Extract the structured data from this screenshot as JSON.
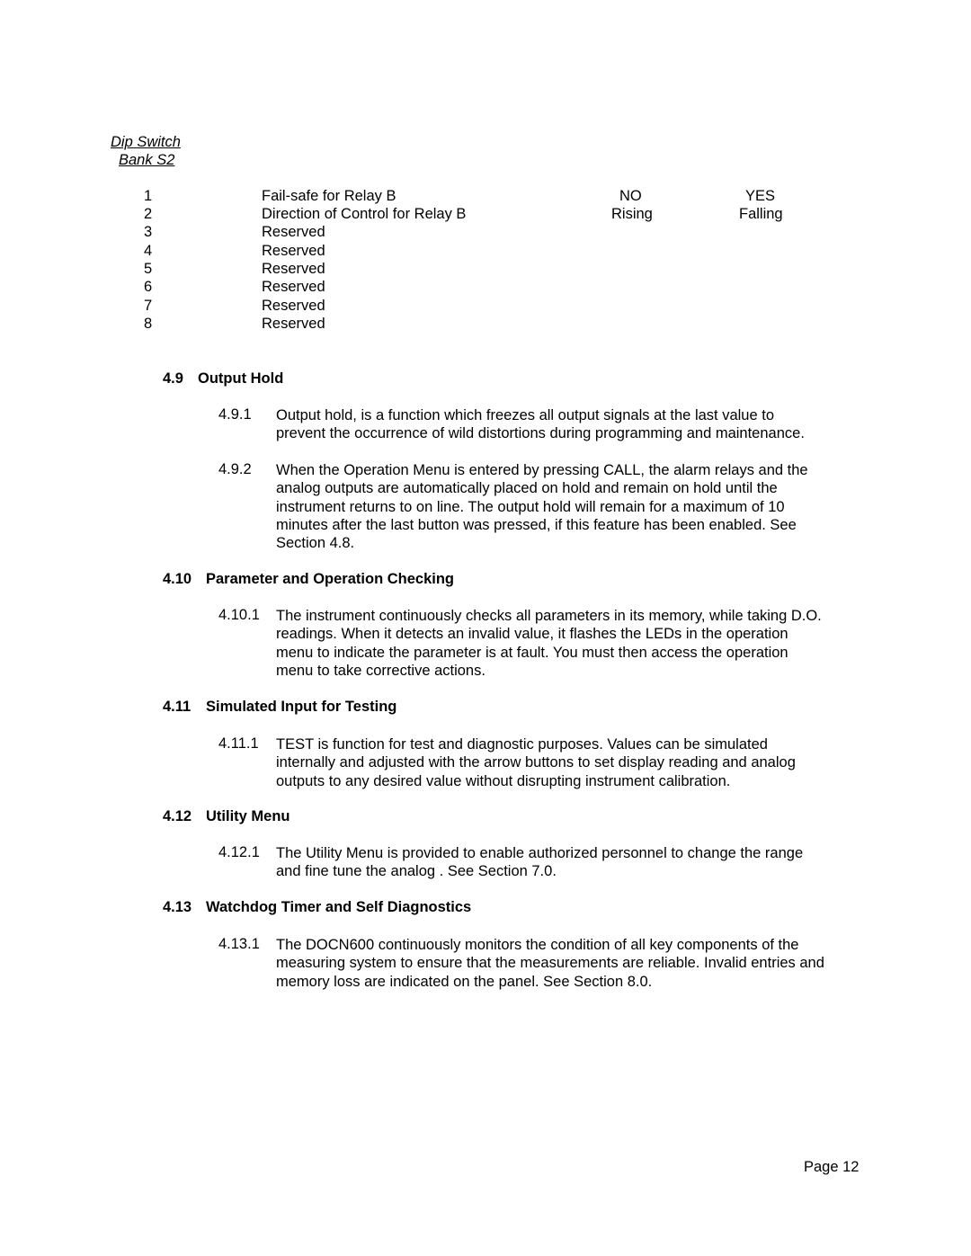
{
  "dip_switch": {
    "caption_line1": "Dip Switch",
    "caption_line2": "Bank S2",
    "rows": [
      {
        "num": "1",
        "desc": "Fail-safe for Relay B",
        "off": "NO",
        "on": "YES"
      },
      {
        "num": "2",
        "desc": "Direction of Control for Relay B",
        "off": "Rising",
        "on": "Falling"
      },
      {
        "num": "3",
        "desc": "Reserved",
        "off": "",
        "on": ""
      },
      {
        "num": "4",
        "desc": "Reserved",
        "off": "",
        "on": ""
      },
      {
        "num": "5",
        "desc": "Reserved",
        "off": "",
        "on": ""
      },
      {
        "num": "6",
        "desc": "Reserved",
        "off": "",
        "on": ""
      },
      {
        "num": "7",
        "desc": "Reserved",
        "off": "",
        "on": ""
      },
      {
        "num": "8",
        "desc": "Reserved",
        "off": "",
        "on": ""
      }
    ]
  },
  "sections": [
    {
      "number": "4.9",
      "title": "Output Hold",
      "paragraphs": [
        {
          "number": "4.9.1",
          "lines": [
            "Output hold, is a function which freezes all output signals at the last value to",
            "prevent the occurrence of wild distortions during programming and maintenance."
          ]
        },
        {
          "number": "4.9.2",
          "lines": [
            "When the Operation Menu is entered by pressing CALL, the alarm relays and the",
            "analog outputs are automatically placed on hold and remain on hold until the",
            "instrument returns to on line.  The output hold will remain for a maximum of 10",
            "minutes after the last button was pressed, if this feature has been enabled. See",
            "Section 4.8."
          ]
        }
      ]
    },
    {
      "number": "4.10",
      "title": "Parameter and Operation Checking",
      "paragraphs": [
        {
          "number": "4.10.1",
          "lines": [
            "The instrument continuously checks all parameters in its memory, while taking D.O.",
            "readings.  When it detects an invalid value, it flashes the LEDs in the operation",
            "menu to indicate the parameter is at fault. You must then access the operation",
            "menu to take corrective actions."
          ]
        }
      ]
    },
    {
      "number": "4.11",
      "title": "Simulated Input for Testing",
      "paragraphs": [
        {
          "number": "4.11.1",
          "lines": [
            "TEST is function for test and diagnostic purposes. Values can be simulated",
            "internally and adjusted with the arrow buttons to set display reading and analog",
            "outputs to any desired value without disrupting instrument calibration."
          ]
        }
      ]
    },
    {
      "number": "4.12",
      "title": "Utility Menu",
      "paragraphs": [
        {
          "number": "4.12.1",
          "lines": [
            "The Utility Menu is provided to enable authorized personnel to change the range",
            "and fine tune the analog .  See Section 7.0."
          ]
        }
      ]
    },
    {
      "number": "4.13",
      "title": "Watchdog Timer and Self Diagnostics",
      "paragraphs": [
        {
          "number": "4.13.1",
          "lines": [
            "The DOCN600 continuously monitors the condition of all key components of the",
            "measuring system to ensure that the measurements are reliable. Invalid entries and",
            "memory loss are indicated on the panel. See Section 8.0."
          ]
        }
      ]
    }
  ],
  "footer": {
    "page_label": "Page 12"
  }
}
